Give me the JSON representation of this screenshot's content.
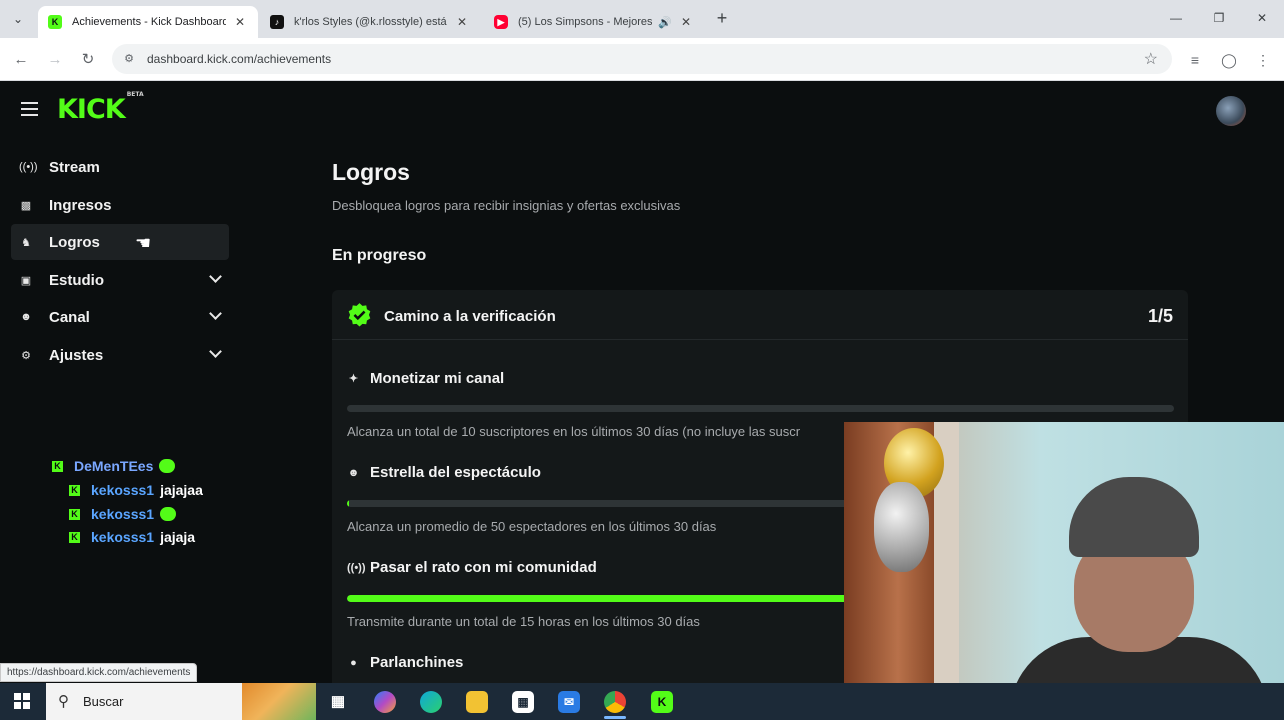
{
  "browser": {
    "tabs": [
      {
        "title": "Achievements - Kick Dashboard",
        "favicon": "kick-icon",
        "active": true
      },
      {
        "title": "k'rlos Styles (@k.rlosstyle) está",
        "favicon": "tiktok-icon",
        "active": false
      },
      {
        "title": "(5) Los Simpsons - Mejores",
        "favicon": "youtube-icon",
        "active": false,
        "audio": true
      }
    ],
    "url": "dashboard.kick.com/achievements",
    "status_url": "https://dashboard.kick.com/achievements"
  },
  "header": {
    "logo": "KICK",
    "logo_badge": "BETA"
  },
  "sidebar": {
    "items": [
      {
        "label": "Stream",
        "icon": "broadcast-icon"
      },
      {
        "label": "Ingresos",
        "icon": "chart-icon"
      },
      {
        "label": "Logros",
        "icon": "trophy-icon",
        "selected": true
      },
      {
        "label": "Estudio",
        "icon": "studio-icon",
        "expandable": true
      },
      {
        "label": "Canal",
        "icon": "users-icon",
        "expandable": true
      },
      {
        "label": "Ajustes",
        "icon": "gear-icon",
        "expandable": true
      }
    ]
  },
  "chat": {
    "rows": [
      {
        "user": "DeMenTEes",
        "message": "",
        "emote": true
      },
      {
        "user": "kekosss1",
        "message": "jajajaa",
        "emote": false
      },
      {
        "user": "kekosss1",
        "message": "",
        "emote": true
      },
      {
        "user": "kekosss1",
        "message": "jajaja",
        "emote": false
      }
    ]
  },
  "main": {
    "title": "Logros",
    "subtitle": "Desbloquea logros para recibir insignias y ofertas exclusivas",
    "section": "En progreso",
    "achievement": {
      "title": "Camino a la verificación",
      "progress": "1/5",
      "tasks": [
        {
          "title": "Monetizar mi canal",
          "icon": "sparkle-icon",
          "progress": 0.0,
          "description": "Alcanza un total de 10 suscriptores en los últimos 30 días (no incluye las suscr"
        },
        {
          "title": "Estrella del espectáculo",
          "icon": "users-icon",
          "progress": 0.003,
          "description": "Alcanza un promedio de 50 espectadores en los últimos 30 días"
        },
        {
          "title": "Pasar el rato con mi comunidad",
          "icon": "broadcast-icon",
          "progress": 1.0,
          "description": "Transmite durante un total de 15 horas en los últimos 30 días"
        },
        {
          "title": "Parlanchines",
          "icon": "chat-icon",
          "progress": null,
          "description": ""
        }
      ]
    }
  },
  "taskbar": {
    "search_placeholder": "Buscar"
  },
  "colors": {
    "accent": "#53fc18",
    "background": "#0b0e0f",
    "card": "#141819",
    "username": "#5aa5ff"
  }
}
